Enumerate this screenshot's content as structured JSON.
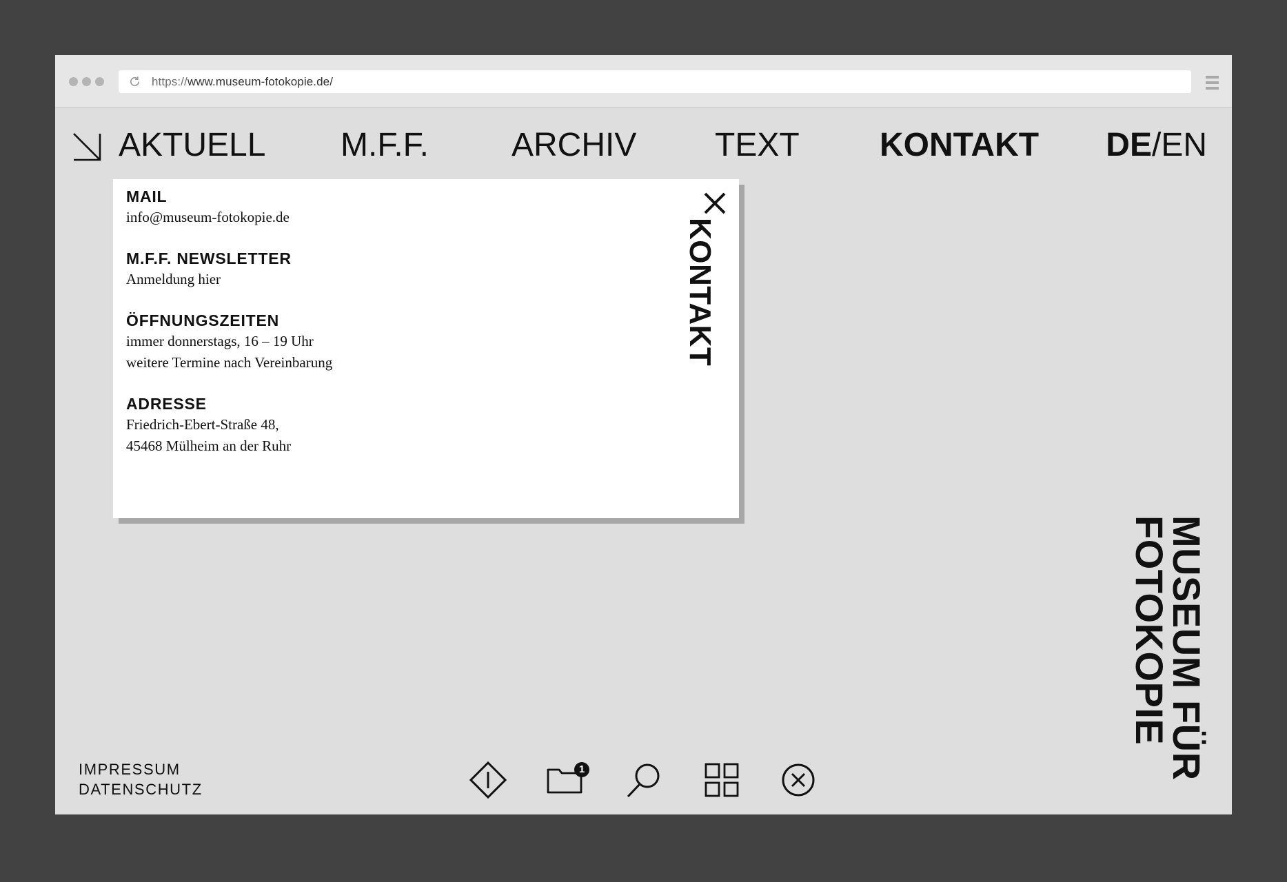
{
  "browser": {
    "url_scheme": "https://",
    "url_host": "www.museum-fotokopie.de/"
  },
  "nav": {
    "items": [
      {
        "label": "AKTUELL"
      },
      {
        "label": "M.F.F."
      },
      {
        "label": "ARCHIV"
      },
      {
        "label": "TEXT"
      },
      {
        "label": "KONTAKT",
        "active": true
      }
    ],
    "lang_current": "DE",
    "lang_separator": "/",
    "lang_other": "EN"
  },
  "panel": {
    "vertical_title": "KONTAKT",
    "sections": [
      {
        "title": "MAIL",
        "lines": [
          "info@museum-fotokopie.de"
        ]
      },
      {
        "title": "M.F.F. NEWSLETTER",
        "lines": [
          "Anmeldung hier"
        ]
      },
      {
        "title": "ÖFFNUNGSZEITEN",
        "lines": [
          "immer donnerstags, 16 – 19 Uhr",
          "weitere Termine nach Vereinbarung"
        ]
      },
      {
        "title": "ADRESSE",
        "lines": [
          "Friedrich-Ebert-Straße 48,",
          "45468 Mülheim an der Ruhr"
        ]
      }
    ]
  },
  "footer": {
    "impressum": "IMPRESSUM",
    "datenschutz": "DATENSCHUTZ"
  },
  "toolbar": {
    "icons": [
      "info-diamond-icon",
      "folder-icon",
      "search-icon",
      "grid-icon",
      "close-circle-icon"
    ],
    "folder_badge": "1"
  },
  "brand": {
    "line1": "MUSEUM FÜR",
    "line2": "FOTOKOPIE"
  }
}
